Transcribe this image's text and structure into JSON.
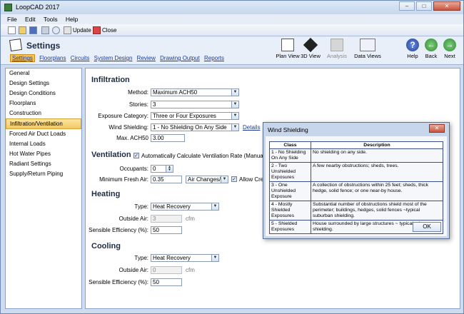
{
  "window": {
    "title": "LoopCAD 2017",
    "min": "–",
    "max": "□",
    "close": "✕"
  },
  "menu": [
    "File",
    "Edit",
    "Tools",
    "Help"
  ],
  "toolbar": {
    "update": "Update",
    "close": "Close"
  },
  "ribbon": {
    "title": "Settings",
    "nav": [
      "Settings",
      "Floorplans",
      "Circuits",
      "System Design",
      "Review",
      "Drawing Output",
      "Reports"
    ],
    "tools": [
      "Plan View",
      "3D View",
      "Analysis",
      "Data Views",
      "Help",
      "Back",
      "Next"
    ]
  },
  "sidebar": [
    "General",
    "Design Settings",
    "Design Conditions",
    "Floorplans",
    "Construction",
    "Infiltration/Ventilation",
    "Forced Air Duct Loads",
    "Internal Loads",
    "Hot Water Pipes",
    "Radiant Settings",
    "Supply/Return Piping"
  ],
  "infiltration": {
    "heading": "Infiltration",
    "method_label": "Method:",
    "method": "Maximum ACH50",
    "stories_label": "Stories:",
    "stories": "3",
    "exposure_label": "Exposure Category:",
    "exposure": "Three or Four Exposures",
    "wind_label": "Wind Shielding:",
    "wind": "1 - No Shielding On Any Side",
    "details": "Details",
    "ach_label": "Max. ACH50",
    "ach": "3.00"
  },
  "ventilation": {
    "heading": "Ventilation",
    "auto_label": "Automatically Calculate Ventilation Rate (Manual J - Table",
    "occupants_label": "Occupants:",
    "occupants": "0",
    "fresh_label": "Minimum Fresh Air:",
    "fresh": "0.35",
    "fresh_unit": "Air Changes/Hr",
    "allow_label": "Allow Cred"
  },
  "heating": {
    "heading": "Heating",
    "type_label": "Type:",
    "type": "Heat Recovery",
    "outside_label": "Outside Air:",
    "outside": "3",
    "outside_unit": "cfm",
    "eff_label": "Sensible Efficiency (%):",
    "eff": "50"
  },
  "cooling": {
    "heading": "Cooling",
    "type_label": "Type:",
    "type": "Heat Recovery",
    "outside_label": "Outside Air:",
    "outside": "0",
    "outside_unit": "cfm",
    "eff_label": "Sensible Efficiency (%):",
    "eff": "50"
  },
  "dialog": {
    "title": "Wind Shielding",
    "col_class": "Class",
    "col_desc": "Description",
    "rows": [
      {
        "cls": "1 - No Shielding On Any Side",
        "desc": "No shielding on any side."
      },
      {
        "cls": "2 - Two Unshielded Exposures",
        "desc": "A few nearby obstructions; sheds, trees."
      },
      {
        "cls": "3 - One Unshielded Exposure",
        "desc": "A collection of obstructions within 25 feet; sheds, thick hedge, solid fence; or one near-by house."
      },
      {
        "cls": "4 - Mostly Shielded Exposures",
        "desc": "Substantial number of obstructions shield most of the perimeter; buildings, hedges, solid fences ~typical suburban shielding."
      },
      {
        "cls": "5 - Shielded Exposures",
        "desc": "House surrounded by large structures ~ typical urban shielding."
      }
    ],
    "ok": "OK"
  }
}
